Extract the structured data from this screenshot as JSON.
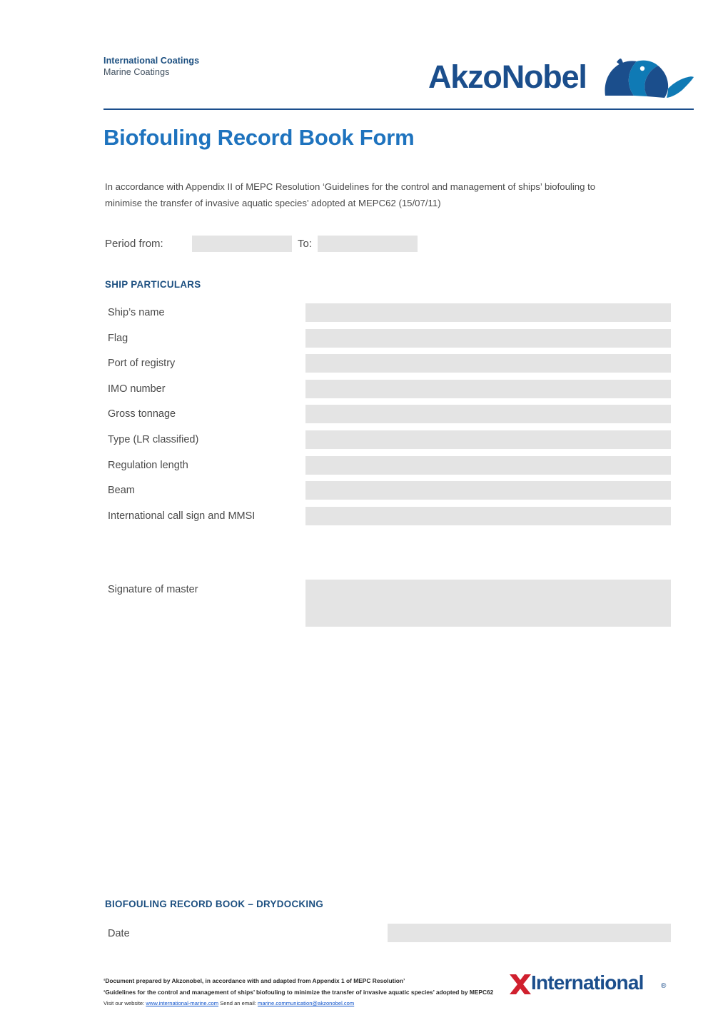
{
  "header": {
    "brand_line1": "International Coatings",
    "brand_line2": "Marine Coatings",
    "logo_wordmark": "AkzoNobel",
    "logo_icon": "akzonobel-figure-icon"
  },
  "title": "Biofouling Record Book Form",
  "intro": "In accordance with Appendix II of MEPC Resolution ‘Guidelines for the control and management of ships’ biofouling to minimise the transfer of invasive aquatic species’ adopted at MEPC62 (15/07/11)",
  "period": {
    "from_label": "Period from:",
    "from_value": "",
    "to_label": "To:",
    "to_value": ""
  },
  "ship_particulars": {
    "heading": "SHIP PARTICULARS",
    "rows": [
      {
        "label": "Ship’s name",
        "value": ""
      },
      {
        "label": "Flag",
        "value": ""
      },
      {
        "label": "Port of registry",
        "value": ""
      },
      {
        "label": "IMO number",
        "value": ""
      },
      {
        "label": "Gross tonnage",
        "value": ""
      },
      {
        "label": "Type (LR classified)",
        "value": ""
      },
      {
        "label": "Regulation length",
        "value": ""
      },
      {
        "label": "Beam",
        "value": ""
      },
      {
        "label": "International call sign and MMSI",
        "value": ""
      }
    ],
    "signature_label": "Signature of master",
    "signature_value": ""
  },
  "drydocking": {
    "heading": "BIOFOULING RECORD BOOK – DRYDOCKING",
    "date_label": "Date",
    "date_value": ""
  },
  "footer": {
    "line1": "‘Document prepared by Akzonobel, in accordance with and adapted from Appendix 1 of MEPC Resolution’",
    "line2": "‘Guidelines for the control and management of ships’ biofouling to minimize the transfer of invasive aquatic species’ adopted by MEPC62",
    "visit_prefix": "Visit our website:",
    "website": "www.international-marine.com",
    "email_prefix": "Send an email:",
    "email": "marine.communication@akzonobel.com",
    "intl_word": "International",
    "intl_reg": "®"
  },
  "colors": {
    "brand_blue": "#1b4e8c",
    "title_blue": "#1e73be",
    "field_gray": "#e4e4e4",
    "body_gray": "#4a4a4a",
    "link_blue": "#1155cc"
  }
}
